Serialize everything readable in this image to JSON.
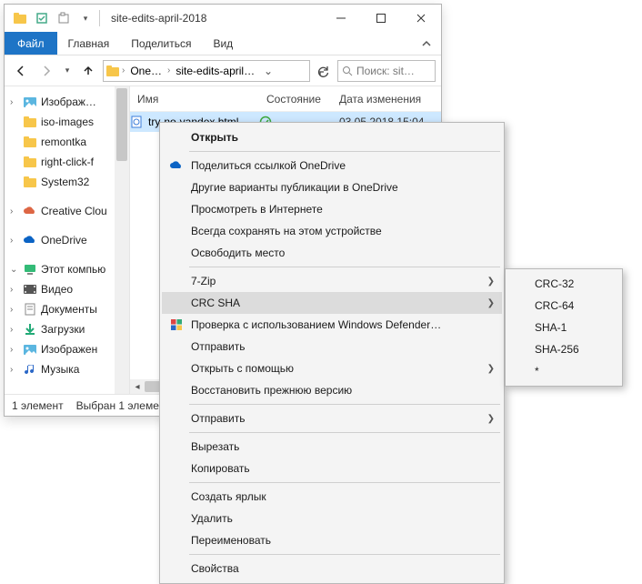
{
  "window": {
    "title": "site-edits-april-2018"
  },
  "ribbon": {
    "file": "Файл",
    "tabs": [
      "Главная",
      "Поделиться",
      "Вид"
    ]
  },
  "address": {
    "crumbs": [
      "One…",
      "site-edits-april…"
    ]
  },
  "search": {
    "placeholder": "Поиск: sit…"
  },
  "tree": {
    "items": [
      {
        "icon": "pictures",
        "label": "Изображ…",
        "expander": ">"
      },
      {
        "icon": "folder",
        "label": "iso-images",
        "expander": ""
      },
      {
        "icon": "folder",
        "label": "remontka",
        "expander": ""
      },
      {
        "icon": "folder",
        "label": "right-click-f",
        "expander": ""
      },
      {
        "icon": "folder",
        "label": "System32",
        "expander": ""
      }
    ],
    "section2": [
      {
        "icon": "cc",
        "label": "Creative Clou",
        "expander": ">"
      }
    ],
    "section3": [
      {
        "icon": "onedrive",
        "label": "OneDrive",
        "expander": ">"
      }
    ],
    "section4": [
      {
        "icon": "pc",
        "label": "Этот компью",
        "expander": "v"
      },
      {
        "icon": "video",
        "label": "Видео",
        "expander": ">"
      },
      {
        "icon": "docs",
        "label": "Документы",
        "expander": ">"
      },
      {
        "icon": "download",
        "label": "Загрузки",
        "expander": ">"
      },
      {
        "icon": "pictures",
        "label": "Изображен",
        "expander": ">"
      },
      {
        "icon": "music",
        "label": "Музыка",
        "expander": ">"
      }
    ]
  },
  "columns": {
    "name": "Имя",
    "state": "Состояние",
    "date": "Дата изменения"
  },
  "file_row": {
    "name": "try-no-yandex.html",
    "state_icon": "synced",
    "date": "03.05.2018 15:04"
  },
  "status": {
    "count": "1 элемент",
    "selection": "Выбран 1 элемен"
  },
  "ctx": {
    "open": "Открыть",
    "share": "Поделиться ссылкой OneDrive",
    "other": "Другие варианты публикации в OneDrive",
    "view_online": "Просмотреть в Интернете",
    "keep": "Всегда сохранять на этом устройстве",
    "free": "Освободить место",
    "sevenzip": "7-Zip",
    "crcsha": "CRC SHA",
    "defender": "Проверка с использованием Windows Defender…",
    "openit": "Отправить",
    "openwith": "Открыть с помощью",
    "restore": "Восстановить прежнюю версию",
    "sendto": "Отправить",
    "cut": "Вырезать",
    "copy": "Копировать",
    "shortcut": "Создать ярлык",
    "delete": "Удалить",
    "rename": "Переименовать",
    "props": "Свойства"
  },
  "submenu": {
    "items": [
      "CRC-32",
      "CRC-64",
      "SHA-1",
      "SHA-256",
      "*"
    ]
  }
}
